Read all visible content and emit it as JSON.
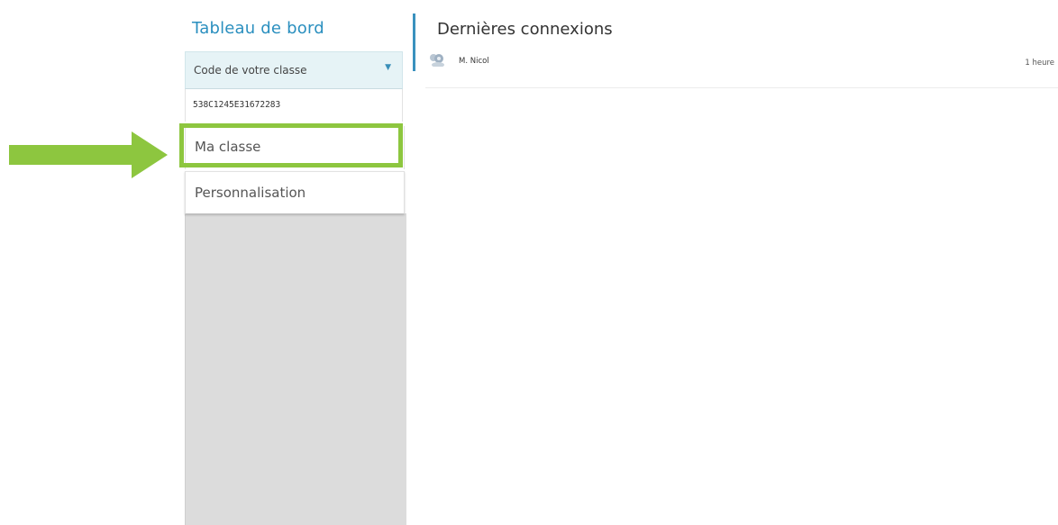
{
  "sidebar": {
    "title": "Tableau de bord",
    "class_code_select": {
      "label": "Code de votre classe",
      "caret_icon": "caret-down-icon"
    },
    "class_code_value": "538C1245E31672283",
    "items": [
      {
        "label": "Ma classe",
        "highlighted": true
      },
      {
        "label": "Personnalisation",
        "highlighted": false
      }
    ]
  },
  "main": {
    "title": "Dernières connexions",
    "connections": [
      {
        "name": "M. Nicol",
        "time": "1 heure",
        "avatar_icon": "user-avatar-icon"
      }
    ]
  },
  "annotation": {
    "arrow_icon": "arrow-right-icon",
    "highlight_color": "#8dc63f"
  },
  "colors": {
    "accent": "#2a8fbf",
    "select_background": "#e6f3f6",
    "sidebar_grey": "#dcdcdc"
  }
}
